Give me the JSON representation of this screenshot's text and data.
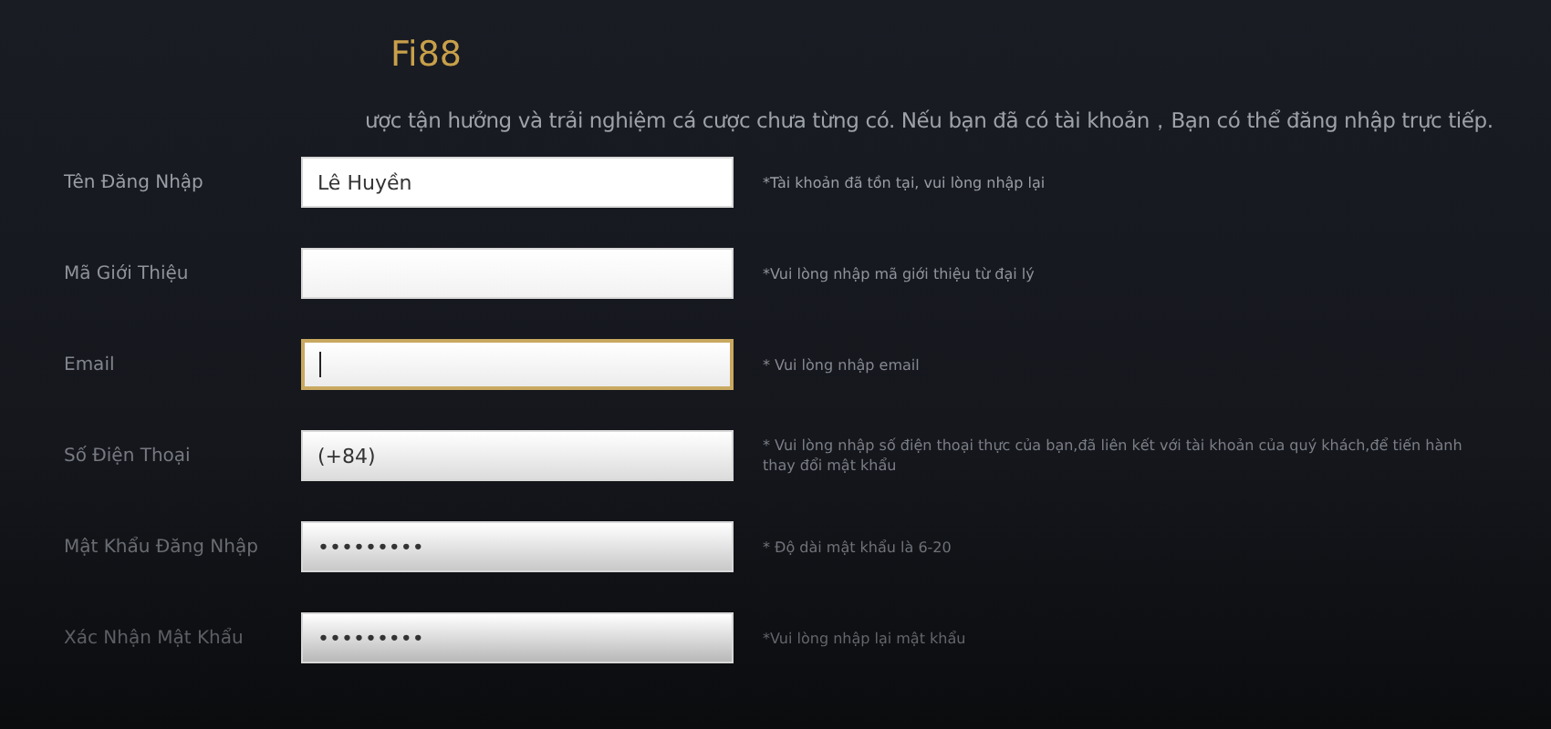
{
  "title": "Fi88",
  "intro": "ược tận hưởng và trải nghiệm cá cược chưa từng có. Nếu bạn đã có tài khoản，Bạn có thể đăng nhập trực tiếp.",
  "fields": [
    {
      "label": "Tên Đăng Nhập",
      "value": "Lê Huyền",
      "focused": false,
      "hint": "*Tài khoản đã tồn tại, vui lòng nhập lại"
    },
    {
      "label": "Mã Giới Thiệu",
      "focused": false,
      "hint": "*Vui lòng nhập mã giới thiệu từ đại lý"
    },
    {
      "label": "Email",
      "focused": true,
      "hint": "* Vui lòng nhập email"
    },
    {
      "label": "Số Điện Thoại",
      "value": "(+84)",
      "focused": false,
      "hint": "* Vui lòng nhập số điện thoại thực của bạn,đã liên kết với tài khoản của quý khách,để tiến hành thay đổi mật khẩu"
    },
    {
      "label": "Mật Khẩu Đăng Nhập",
      "value": "•••••••••",
      "focused": false,
      "hint": "* Độ dài mật khẩu là 6-20"
    },
    {
      "label": "Xác Nhận Mật Khẩu",
      "value": "•••••••••",
      "focused": false,
      "hint": "*Vui lòng nhập lại mật khẩu"
    }
  ]
}
